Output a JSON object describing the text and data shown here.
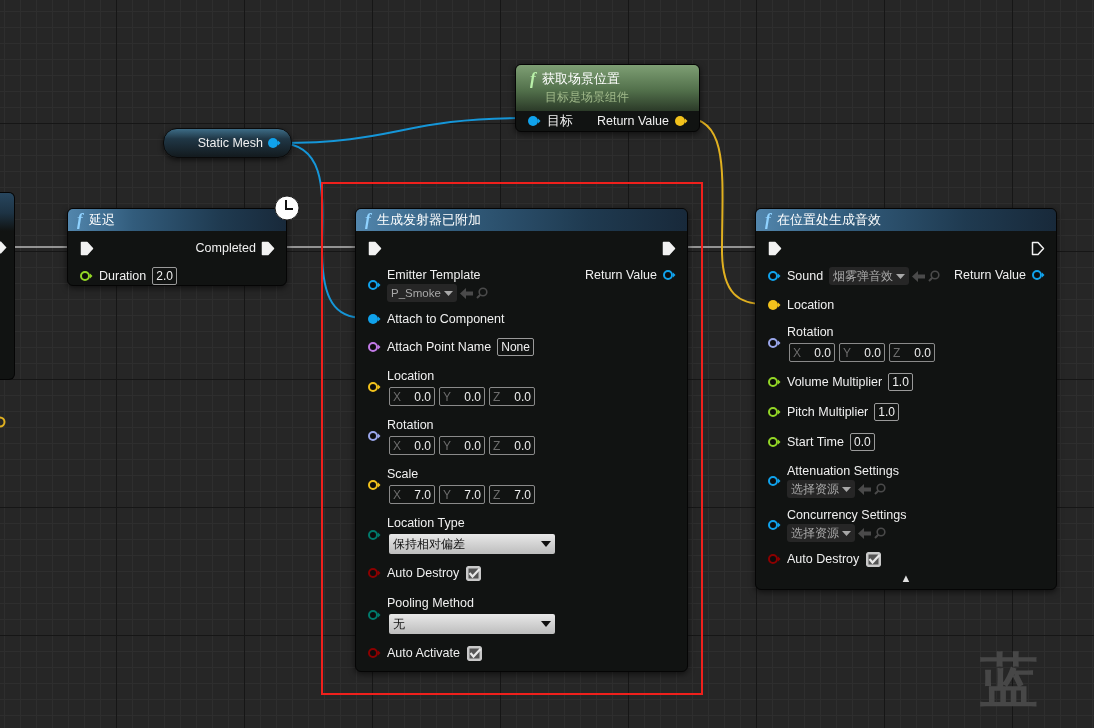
{
  "nodes": [
    {
      "kind": "variable",
      "title": "Static Mesh",
      "color": "#10a2ec",
      "connected": true
    },
    {
      "kind": "pure",
      "icon": "f",
      "title": "获取场景位置",
      "subtitle": "目标是场景组件",
      "inputs": [
        {
          "kind": "plain",
          "label": "目标",
          "color": "#10a2ec",
          "connected": true
        }
      ],
      "outputs": [
        {
          "label": "Return Value",
          "color": "#f2c21c",
          "connected": true
        }
      ]
    },
    {
      "kind": "call",
      "icon": "f",
      "title": "延迟",
      "latent": true,
      "exec_in": {
        "connected": true
      },
      "exec_out": {
        "label": "Completed",
        "connected": true
      },
      "inputs": [
        {
          "kind": "number",
          "label": "Duration",
          "value": "2.0",
          "color": "#93d626",
          "connected": false
        }
      ]
    },
    {
      "kind": "call",
      "icon": "f",
      "title": "生成发射器已附加",
      "highlighted": true,
      "exec_in": {
        "connected": true
      },
      "exec_out": {
        "connected": true
      },
      "inputs": [
        {
          "kind": "asset",
          "label": "Emitter Template",
          "value": "P_Smoke",
          "color": "#10a2ec",
          "connected": false
        },
        {
          "kind": "plain",
          "label": "Attach to Component",
          "color": "#10a2ec",
          "connected": true
        },
        {
          "kind": "name",
          "label": "Attach Point Name",
          "value": "None",
          "color": "#c27ae6",
          "connected": false
        },
        {
          "kind": "vector",
          "label": "Location",
          "color": "#f2c21c",
          "connected": false,
          "components": [
            {
              "axis": "X",
              "value": "0.0"
            },
            {
              "axis": "Y",
              "value": "0.0"
            },
            {
              "axis": "Z",
              "value": "0.0"
            }
          ]
        },
        {
          "kind": "vector",
          "label": "Rotation",
          "color": "#9aa6ea",
          "connected": false,
          "components": [
            {
              "axis": "X",
              "value": "0.0"
            },
            {
              "axis": "Y",
              "value": "0.0"
            },
            {
              "axis": "Z",
              "value": "0.0"
            }
          ]
        },
        {
          "kind": "vector",
          "label": "Scale",
          "color": "#f2c21c",
          "connected": false,
          "components": [
            {
              "axis": "X",
              "value": "7.0"
            },
            {
              "axis": "Y",
              "value": "7.0"
            },
            {
              "axis": "Z",
              "value": "7.0"
            }
          ]
        },
        {
          "kind": "enum",
          "label": "Location Type",
          "value": "保持相对偏差",
          "color": "#007a6c",
          "connected": false
        },
        {
          "kind": "checkbox",
          "label": "Auto Destroy",
          "checked": true,
          "color": "#8c0000",
          "connected": false
        },
        {
          "kind": "enum",
          "label": "Pooling Method",
          "value": "无",
          "color": "#007a6c",
          "connected": false
        },
        {
          "kind": "checkbox",
          "label": "Auto Activate",
          "checked": true,
          "color": "#8c0000",
          "connected": false
        }
      ],
      "outputs": [
        {
          "label": "Return Value",
          "color": "#10a2ec",
          "connected": false
        }
      ]
    },
    {
      "kind": "call",
      "icon": "f",
      "title": "在位置处生成音效",
      "exec_in": {
        "connected": true
      },
      "exec_out": {
        "connected": false
      },
      "advanced_toggle": "▲",
      "inputs": [
        {
          "kind": "asset_inline",
          "label": "Sound",
          "value": "烟雾弹音效",
          "color": "#10a2ec",
          "connected": false
        },
        {
          "kind": "plain",
          "label": "Location",
          "color": "#f2c21c",
          "connected": true
        },
        {
          "kind": "vector",
          "label": "Rotation",
          "color": "#9aa6ea",
          "connected": false,
          "components": [
            {
              "axis": "X",
              "value": "0.0"
            },
            {
              "axis": "Y",
              "value": "0.0"
            },
            {
              "axis": "Z",
              "value": "0.0"
            }
          ]
        },
        {
          "kind": "number",
          "label": "Volume Multiplier",
          "value": "1.0",
          "color": "#93d626",
          "connected": false
        },
        {
          "kind": "number",
          "label": "Pitch Multiplier",
          "value": "1.0",
          "color": "#93d626",
          "connected": false
        },
        {
          "kind": "number",
          "label": "Start Time",
          "value": "0.0",
          "color": "#93d626",
          "connected": false
        },
        {
          "kind": "asset",
          "label": "Attenuation Settings",
          "value": "选择资源",
          "color": "#10a2ec",
          "connected": false
        },
        {
          "kind": "asset",
          "label": "Concurrency Settings",
          "value": "选择资源",
          "color": "#10a2ec",
          "connected": false
        },
        {
          "kind": "checkbox",
          "label": "Auto Destroy",
          "checked": true,
          "color": "#8c0000",
          "connected": false
        }
      ],
      "outputs": [
        {
          "label": "Return Value",
          "color": "#10a2ec",
          "connected": false
        }
      ]
    }
  ],
  "graph_label": "蓝"
}
